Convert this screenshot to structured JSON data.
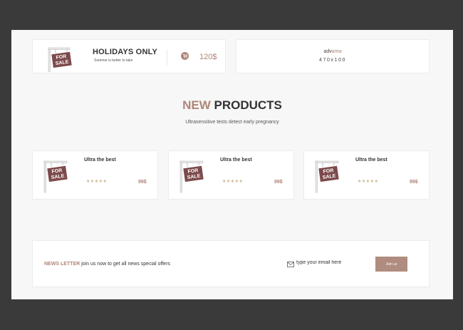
{
  "promo": {
    "title": "HOLIDAYS ONLY",
    "subtitle": "Summer is better to take",
    "price": "120$",
    "sign_text": [
      "FOR",
      "SALE"
    ],
    "icons": [
      "for-sale-sign-icon",
      "cart-icon"
    ]
  },
  "advert": {
    "label_part1": "adv",
    "label_part2": "area",
    "size": "470x100"
  },
  "section": {
    "title_highlight": "NEW",
    "title_rest": "PRODUCTS",
    "subtitle": "Ultrasensitive tests detect early pregnancy"
  },
  "products": [
    {
      "name": "Ultra the best",
      "stars": "★★★★★",
      "rating": 5,
      "price": "99$"
    },
    {
      "name": "Ultra the best",
      "stars": "★★★★★",
      "rating": 5,
      "price": "99$"
    },
    {
      "name": "Ultra the best",
      "stars": "★★★★★",
      "rating": 5,
      "price": "99$"
    }
  ],
  "newsletter": {
    "label": "NEWS LETTER",
    "text": "join us now to get all news special offers",
    "placeholder": "type your email here",
    "button": "Join us",
    "icon": "mail-icon"
  },
  "colors": {
    "accent": "#b08578",
    "button": "#b08c80",
    "stars": "#c9b48a",
    "background": "#f6f7f6",
    "frame": "#3a3a3a"
  }
}
